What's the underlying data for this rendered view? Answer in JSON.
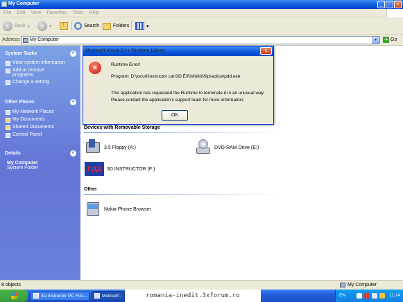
{
  "window": {
    "title": "My Computer"
  },
  "menu": [
    "File",
    "Edit",
    "View",
    "Favorites",
    "Tools",
    "Help"
  ],
  "toolbar": {
    "back_label": "Back",
    "search_label": "Search",
    "folders_label": "Folders"
  },
  "address": {
    "label": "Address",
    "value": "My Computer",
    "go_label": "Go"
  },
  "sidebar": {
    "system_tasks": {
      "title": "System Tasks",
      "items": [
        "View system information",
        "Add or remove programs",
        "Change a setting"
      ]
    },
    "other_places": {
      "title": "Other Places",
      "items": [
        "My Network Places",
        "My Documents",
        "Shared Documents",
        "Control Panel"
      ]
    },
    "details": {
      "title": "Details",
      "name": "My Computer",
      "type": "System Folder"
    }
  },
  "content": {
    "removable_title": "Devices with Removable Storage",
    "devices": [
      "3.5 Floppy (A:)",
      "DVD-RAM Drive (E:)",
      "3D INSTRUCTOR (F:)"
    ],
    "other_title": "Other",
    "other_items": [
      "Nokia Phone Browser"
    ],
    "instructor_logo_text": "ПДД"
  },
  "dialog": {
    "title": "Microsoft Visual C++ Runtime Library",
    "close_label": "x",
    "heading": "Runtime Error!",
    "program": "Program: D:\\jocuri\\instructor car\\3D Èíñòðóêòîð\\practice\\pdd.exe",
    "message_line1": "This application has requested the Runtime to terminate it in an unusual way.",
    "message_line2": "Please contact the application's support team for more information.",
    "ok_label": "OK"
  },
  "status": {
    "objects": "8 objects",
    "location": "My Computer"
  },
  "taskbar": {
    "tasks": [
      "3D Instructor PC FUL...",
      "Multisoft -"
    ],
    "watermark": "romania-inedit.3xforum.ro",
    "language": "EN",
    "clock": "11:14"
  },
  "colors": {
    "titlebar": "#0a56d8",
    "sidebar": "#6375d6",
    "error_icon": "#c41a0d",
    "taskbar": "#245edb"
  }
}
